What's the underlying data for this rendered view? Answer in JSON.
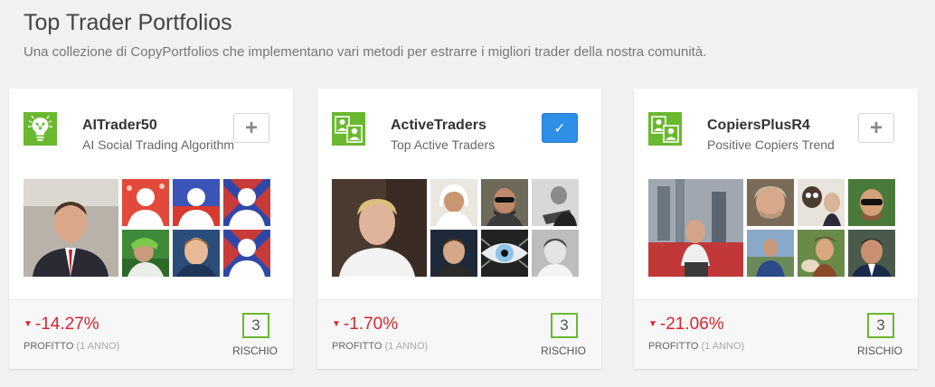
{
  "header": {
    "title": "Top Trader Portfolios",
    "subtitle": "Una collezione di CopyPortfolios che implementano vari metodi per estrarre i migliori trader della nostra comunità."
  },
  "colors": {
    "brand_green": "#6ab82f",
    "loss_red": "#d9252e",
    "checked_blue": "#2d8fe6"
  },
  "cards": [
    {
      "name": "AITrader50",
      "description": "AI Social Trading Algorithm",
      "logo_icon": "ai-brain-bulb-icon",
      "action_icon": "plus-icon",
      "action": "+",
      "selected": false,
      "gain": "-14.27%",
      "gain_label": "PROFITTO",
      "gain_period": "(1 ANNO)",
      "risk": "3",
      "risk_label": "RISCHIO"
    },
    {
      "name": "ActiveTraders",
      "description": "Top Active Traders",
      "logo_icon": "people-portfolio-icon",
      "action_icon": "check-icon",
      "action": "✓",
      "selected": true,
      "gain": "-1.70%",
      "gain_label": "PROFITTO",
      "gain_period": "(1 ANNO)",
      "risk": "3",
      "risk_label": "RISCHIO"
    },
    {
      "name": "CopiersPlusR4",
      "description": "Positive Copiers Trend",
      "logo_icon": "people-portfolio-icon",
      "action_icon": "plus-icon",
      "action": "+",
      "selected": false,
      "gain": "-21.06%",
      "gain_label": "PROFITTO",
      "gain_period": "(1 ANNO)",
      "risk": "3",
      "risk_label": "RISCHIO"
    }
  ]
}
